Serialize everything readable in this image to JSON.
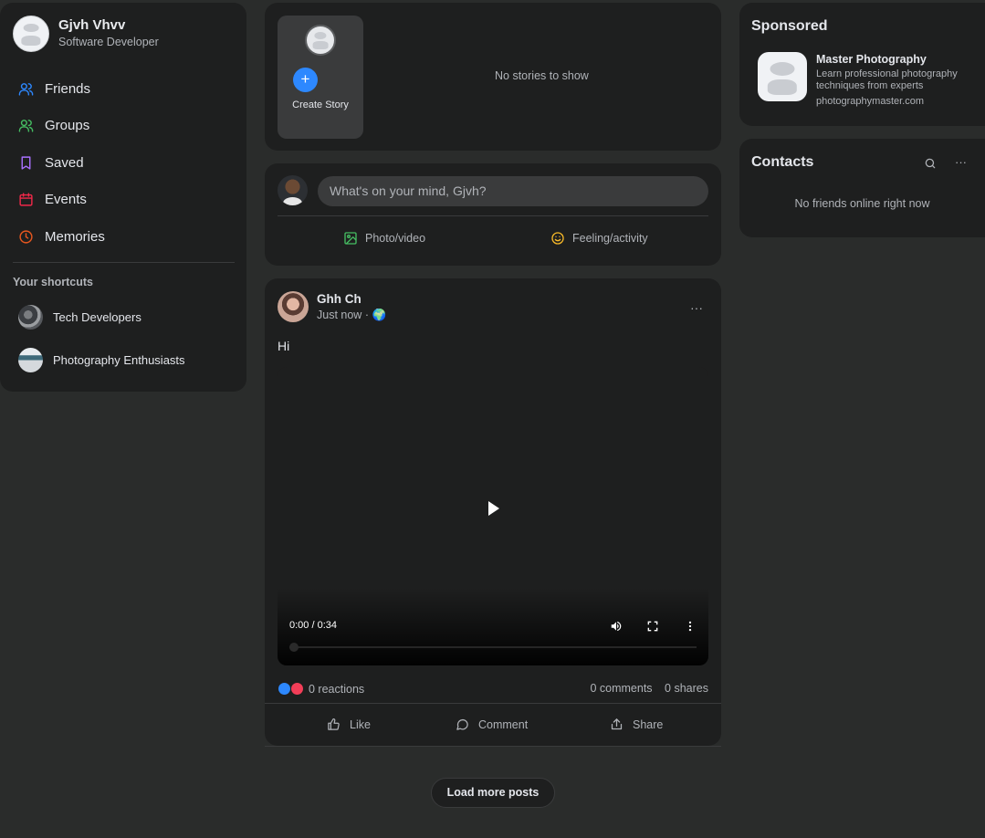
{
  "profile": {
    "name": "Gjvh Vhvv",
    "role": "Software Developer"
  },
  "nav": {
    "friends": "Friends",
    "groups": "Groups",
    "saved": "Saved",
    "events": "Events",
    "memories": "Memories"
  },
  "shortcuts": {
    "title": "Your shortcuts",
    "items": [
      {
        "label": "Tech Developers"
      },
      {
        "label": "Photography Enthusiasts"
      }
    ]
  },
  "stories": {
    "create_label": "Create Story",
    "plus": "+",
    "empty": "No stories to show"
  },
  "composer": {
    "placeholder": "What's on your mind, Gjvh?",
    "photo": "Photo/video",
    "feeling": "Feeling/activity"
  },
  "post": {
    "author": "Ghh Ch",
    "time": "Just now",
    "separator": "·",
    "audience": "🌍",
    "menu": "···",
    "text": "Hi",
    "video_time": "0:00 / 0:34",
    "reactions": "0 reactions",
    "comments": "0 comments",
    "shares": "0 shares",
    "like": "Like",
    "comment": "Comment",
    "share": "Share"
  },
  "load_more": "Load more posts",
  "sponsored": {
    "title": "Sponsored",
    "ad_title": "Master Photography",
    "ad_desc": "Learn professional photography techniques from experts",
    "ad_url": "photographymaster.com"
  },
  "contacts": {
    "title": "Contacts",
    "menu": "···",
    "empty": "No friends online right now"
  },
  "colors": {
    "accent": "#2d88ff",
    "love": "#f33e58",
    "groups": "#45bd62",
    "saved": "#a970ff",
    "events": "#f02849",
    "memories": "#e8571f",
    "feeling": "#f7b928"
  }
}
